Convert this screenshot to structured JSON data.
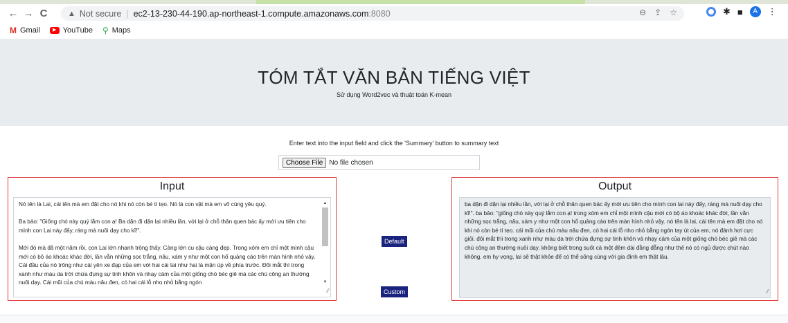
{
  "browser": {
    "nav": {
      "back": "←",
      "forward": "→",
      "reload": "C"
    },
    "security_label": "Not secure",
    "url_host": "ec2-13-230-44-190.ap-northeast-1.compute.amazonaws.com",
    "url_port": ":8080",
    "profile_initial": "A",
    "bookmarks": [
      {
        "label": "Gmail",
        "icon": "gmail-icon"
      },
      {
        "label": "YouTube",
        "icon": "youtube-icon"
      },
      {
        "label": "Maps",
        "icon": "maps-icon"
      }
    ]
  },
  "hero": {
    "title": "TÓM TẮT VĂN BẢN TIẾNG VIỆT",
    "subtitle": "Sử dụng Word2vec và thuật toán K-mean"
  },
  "instructions": "Enter text into the input field and click the 'Summary' button to summary text",
  "file_input": {
    "button_label": "Choose File",
    "status": "No file chosen"
  },
  "input_panel": {
    "title": "Input",
    "paragraphs": [
      "Nó tên là Lai, cái tên mà em đặt cho nó khi nó còn bé tí tẹo. Nó là con vật mà em vô cùng yêu quý.",
      "Ba bảo: \"Giống chó này quý lắm con ạ! Ba dặn đi dặn lại nhiều lần, với lại ở chỗ thân quen bác ấy mới ưu tiên cho mình con Lai này đấy, ráng mà nuôi dạy cho kĩ!\".",
      "Mới đó mà đã một năm rồi, con Lai lớn nhanh trông thấy. Càng lớn cu cậu càng đẹp. Trong xóm em chỉ một mình cậu mới có bộ áo khoác khác đời, lần vằn những sọc trắng, nâu, xám y như một con hổ quảng cáo trên màn hình nhỏ vậy. Cái đầu của nó trông như cái yên xe đạp của em với hai cái tai như hai lá mận úp về phía trước. Đôi mắt thì trong xanh như màu da trời chứa đựng sự tinh khôn và nhạy cảm của một giống chó béc giê mà các chú công an thường nuôi dạy. Cái mũi của chú màu nâu đen, có hai cái lỗ nho nhỏ bằng ngón"
    ]
  },
  "output_panel": {
    "title": "Output",
    "text": "ba dặn đi dặn lại nhiều lần, với lại ở chỗ thân quen bác ấy mới ưu tiên cho mình con lai này đấy, ráng mà nuôi dạy cho kĩ!\". ba bảo: \"giống chó này quý lắm con ạ! trong xóm em chỉ một mình cậu mới có bộ áo khoác khác đời, lần vằn những sọc trắng, nâu, xám y như một con hổ quảng cáo trên màn hình nhỏ vậy. nó tên là lai, cái tên mà em đặt cho nó khi nó còn bé tí tẹo. cái mũi của chú màu nâu đen, có hai cái lỗ nho nhỏ bằng ngón tay út của em, nó đánh hơi cực giỏi. đôi mắt thì trong xanh như màu da trời chứa đựng sự tinh khôn và nhạy cảm của một giống chó béc giê mà các chú công an thường nuôi dạy. không biết trong suốt cả một đêm dài đằng đẵng như thế nó có ngủ được chút nào không. em hy vọng, lai sẽ thật khỏe để có thể sống cùng với gia đình em thật lâu."
  },
  "buttons": {
    "default": "Default",
    "custom": "Custom"
  }
}
